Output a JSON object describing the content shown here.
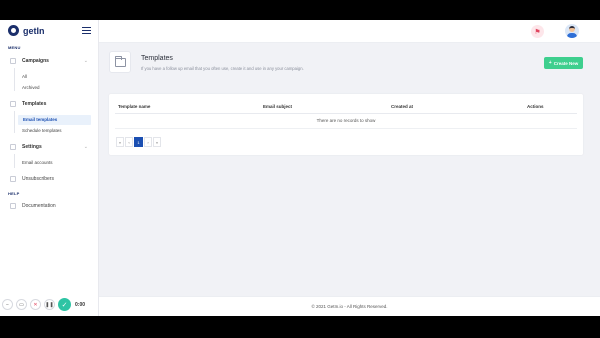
{
  "brand": {
    "name": "getIn"
  },
  "sidebar": {
    "menu_label": "MENU",
    "campaigns": {
      "label": "Campaigns",
      "children": [
        "All",
        "Archived"
      ]
    },
    "templates": {
      "label": "Templates",
      "children": [
        "Email templates",
        "Schedule templates"
      ]
    },
    "settings": {
      "label": "Settings",
      "children": [
        "Email accounts"
      ]
    },
    "unsubscribers": "Unsubscribers",
    "help_label": "HELP",
    "documentation": "Documentation"
  },
  "page": {
    "title": "Templates",
    "subtitle": "If you have a follow up email that you often use, create it and use in any your campaign.",
    "create_button": "Create New"
  },
  "table": {
    "columns": [
      "Template name",
      "Email subject",
      "Created at",
      "Actions"
    ],
    "empty_text": "There are no records to show"
  },
  "pagination": {
    "first": "«",
    "prev": "‹",
    "current": "1",
    "next": "›",
    "last": "»"
  },
  "footer": {
    "text": "© 2021 GetIn.io - All Rights Reserved."
  },
  "recorder": {
    "time": "0:00"
  },
  "colors": {
    "brand": "#1b2f6b",
    "accent": "#1b4fb2",
    "create": "#3ecf8e"
  }
}
